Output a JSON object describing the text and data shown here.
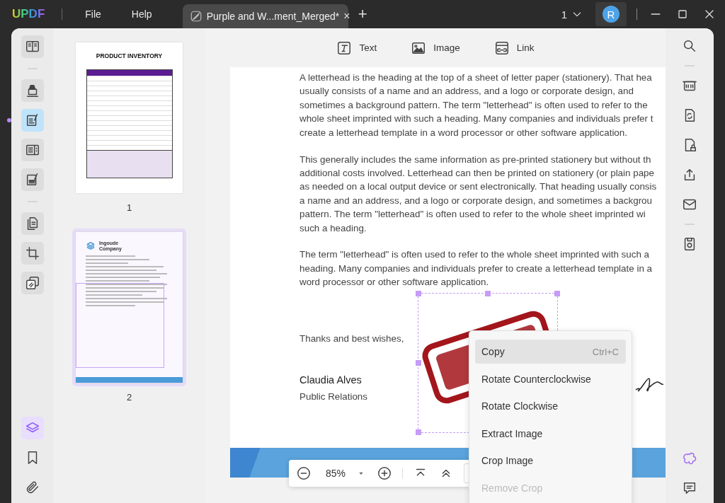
{
  "titlebar": {
    "logo": "UPDF",
    "menu": [
      {
        "label": "File"
      },
      {
        "label": "Help"
      }
    ],
    "tab": {
      "title": "Purple and W...ment_Merged*",
      "close": "×",
      "selected": true
    },
    "new_tab": "+",
    "page_number": "1",
    "avatar": "R"
  },
  "left_tools": [
    {
      "selected": false
    },
    {
      "selected": false
    },
    {
      "selected": true
    },
    {
      "selected": false
    },
    {
      "selected": false
    },
    {
      "selected": false
    },
    {
      "selected": false
    },
    {
      "selected": false
    }
  ],
  "left_bottom_tools": [
    {
      "selected": true
    },
    {
      "selected": false
    },
    {
      "selected": false
    }
  ],
  "thumbnails": [
    {
      "kind": "table",
      "title": "PRODUCT INVENTORY",
      "page": "1",
      "selected": false
    },
    {
      "kind": "letter",
      "title": "Ingoude Company",
      "page": "2",
      "selected": true
    }
  ],
  "edit_toolbar": [
    {
      "label": "Text"
    },
    {
      "label": "Image"
    },
    {
      "label": "Link"
    }
  ],
  "document": {
    "paragraphs": [
      [
        "A letterhead is the heading at the top of a sheet of letter paper (stationery). That hea",
        "usually consists of a name and an address, and a logo or corporate design, and",
        "sometimes a background pattern. The term \"letterhead\" is often used to refer to the",
        "whole sheet imprinted with such a heading. Many companies and individuals prefer t",
        "create a letterhead template in a word processor or other software application."
      ],
      [
        "This generally includes the same information as pre-printed stationery but without th",
        "additional costs involved. Letterhead can then be printed on stationery (or plain pape",
        "as needed on a local output device or sent electronically. That heading usually consis",
        "a name and an address, and a logo or corporate design, and sometimes a backgrou",
        "pattern. The term \"letterhead\" is often used to refer to the whole sheet imprinted wi",
        "such a heading."
      ],
      [
        "The term \"letterhead\" is often used to refer to the whole sheet imprinted with such a",
        "heading. Many companies and individuals prefer to create a letterhead template in a",
        "word processor or other software application."
      ]
    ],
    "closing": "Thanks and best wishes,",
    "signer_name": "Claudia Alves",
    "signer_title": "Public Relations"
  },
  "zoom_bar": {
    "zoom": "85%"
  },
  "context_menu": [
    {
      "label": "Copy",
      "shortcut": "Ctrl+C",
      "selected": true,
      "disabled": false
    },
    {
      "label": "Rotate Counterclockwise",
      "selected": false,
      "disabled": false
    },
    {
      "label": "Rotate Clockwise",
      "selected": false,
      "disabled": false
    },
    {
      "label": "Extract Image",
      "selected": false,
      "disabled": false
    },
    {
      "label": "Crop Image",
      "selected": false,
      "disabled": false
    },
    {
      "label": "Remove Crop",
      "selected": false,
      "disabled": true
    }
  ]
}
